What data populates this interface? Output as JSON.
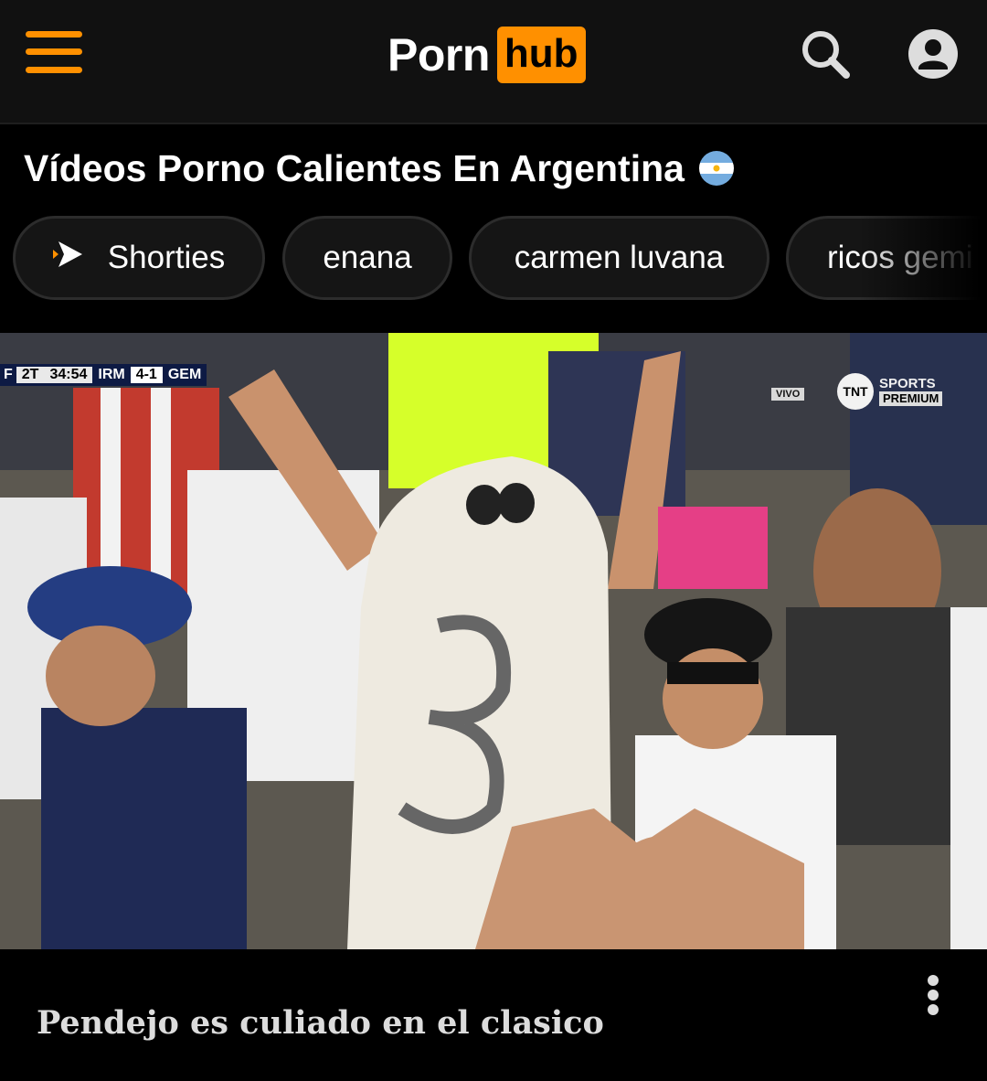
{
  "header": {
    "logo_left": "Porn",
    "logo_right": "hub",
    "accent_color": "#ff9000",
    "icons": [
      "menu-icon",
      "search-icon",
      "account-icon"
    ]
  },
  "page": {
    "title": "Vídeos Porno Calientes En Argentina",
    "flag_icon": "argentina-flag-icon"
  },
  "chips": [
    {
      "label": "Shorties",
      "icon": "play-arrow-icon"
    },
    {
      "label": "enana"
    },
    {
      "label": "carmen luvana"
    },
    {
      "label": "ricos gemi"
    }
  ],
  "video": {
    "title": "Pendejo es culiado en el clasico",
    "overlay": {
      "period": "2T",
      "clock": "34:54",
      "home": "IRM",
      "score": "4-1",
      "away": "GEM",
      "left_cut": "F",
      "live": "VIVO",
      "network": "TNT",
      "network_line1": "SPORTS",
      "network_line2": "PREMIUM"
    }
  }
}
